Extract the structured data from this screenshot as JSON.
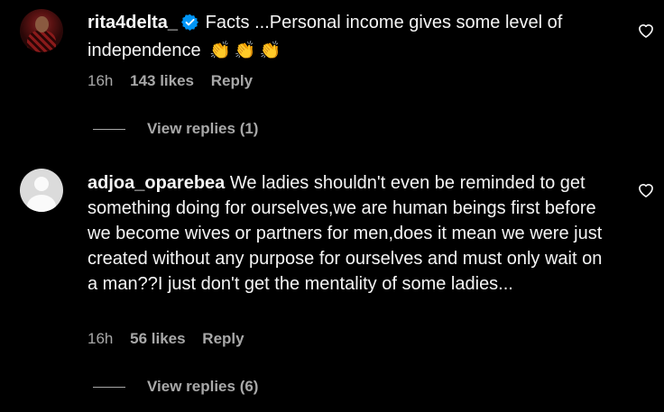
{
  "comments": [
    {
      "username": "rita4delta_",
      "verified": true,
      "text": "Facts ...Personal income gives some level of independence",
      "emojis": [
        "👏",
        "👏",
        "👏"
      ],
      "time": "16h",
      "likes": "143 likes",
      "reply": "Reply",
      "view_replies": "View replies (1)"
    },
    {
      "username": "adjoa_oparebea",
      "verified": false,
      "text": "We ladies shouldn't even be reminded to get something doing for ourselves,we are human beings first before we become wives or partners for men,does it mean we were just created without any purpose for ourselves and must only wait on a man??I just don't get the mentality of some ladies...",
      "time": "16h",
      "likes": "56 likes",
      "reply": "Reply",
      "view_replies": "View replies (6)"
    }
  ],
  "colors": {
    "background": "#000000",
    "primary_text": "#f5f5f5",
    "secondary_text": "#a8a8a8",
    "verified_badge": "#0095f6"
  }
}
